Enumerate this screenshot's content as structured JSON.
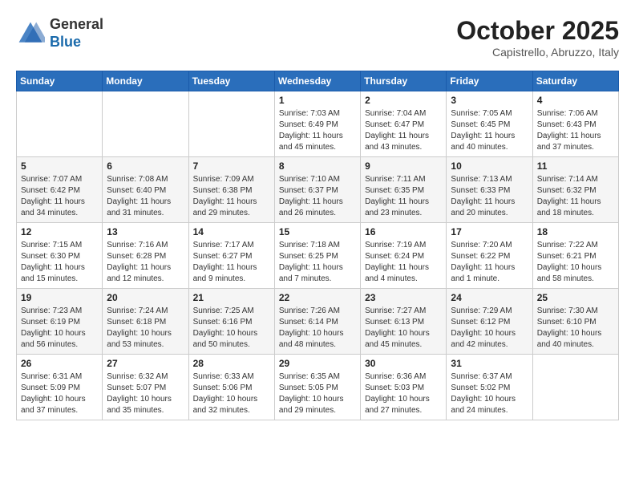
{
  "header": {
    "logo": {
      "general": "General",
      "blue": "Blue"
    },
    "title": "October 2025",
    "subtitle": "Capistrello, Abruzzo, Italy"
  },
  "calendar": {
    "weekdays": [
      "Sunday",
      "Monday",
      "Tuesday",
      "Wednesday",
      "Thursday",
      "Friday",
      "Saturday"
    ],
    "weeks": [
      [
        {
          "day": "",
          "info": ""
        },
        {
          "day": "",
          "info": ""
        },
        {
          "day": "",
          "info": ""
        },
        {
          "day": "1",
          "info": "Sunrise: 7:03 AM\nSunset: 6:49 PM\nDaylight: 11 hours and 45 minutes."
        },
        {
          "day": "2",
          "info": "Sunrise: 7:04 AM\nSunset: 6:47 PM\nDaylight: 11 hours and 43 minutes."
        },
        {
          "day": "3",
          "info": "Sunrise: 7:05 AM\nSunset: 6:45 PM\nDaylight: 11 hours and 40 minutes."
        },
        {
          "day": "4",
          "info": "Sunrise: 7:06 AM\nSunset: 6:43 PM\nDaylight: 11 hours and 37 minutes."
        }
      ],
      [
        {
          "day": "5",
          "info": "Sunrise: 7:07 AM\nSunset: 6:42 PM\nDaylight: 11 hours and 34 minutes."
        },
        {
          "day": "6",
          "info": "Sunrise: 7:08 AM\nSunset: 6:40 PM\nDaylight: 11 hours and 31 minutes."
        },
        {
          "day": "7",
          "info": "Sunrise: 7:09 AM\nSunset: 6:38 PM\nDaylight: 11 hours and 29 minutes."
        },
        {
          "day": "8",
          "info": "Sunrise: 7:10 AM\nSunset: 6:37 PM\nDaylight: 11 hours and 26 minutes."
        },
        {
          "day": "9",
          "info": "Sunrise: 7:11 AM\nSunset: 6:35 PM\nDaylight: 11 hours and 23 minutes."
        },
        {
          "day": "10",
          "info": "Sunrise: 7:13 AM\nSunset: 6:33 PM\nDaylight: 11 hours and 20 minutes."
        },
        {
          "day": "11",
          "info": "Sunrise: 7:14 AM\nSunset: 6:32 PM\nDaylight: 11 hours and 18 minutes."
        }
      ],
      [
        {
          "day": "12",
          "info": "Sunrise: 7:15 AM\nSunset: 6:30 PM\nDaylight: 11 hours and 15 minutes."
        },
        {
          "day": "13",
          "info": "Sunrise: 7:16 AM\nSunset: 6:28 PM\nDaylight: 11 hours and 12 minutes."
        },
        {
          "day": "14",
          "info": "Sunrise: 7:17 AM\nSunset: 6:27 PM\nDaylight: 11 hours and 9 minutes."
        },
        {
          "day": "15",
          "info": "Sunrise: 7:18 AM\nSunset: 6:25 PM\nDaylight: 11 hours and 7 minutes."
        },
        {
          "day": "16",
          "info": "Sunrise: 7:19 AM\nSunset: 6:24 PM\nDaylight: 11 hours and 4 minutes."
        },
        {
          "day": "17",
          "info": "Sunrise: 7:20 AM\nSunset: 6:22 PM\nDaylight: 11 hours and 1 minute."
        },
        {
          "day": "18",
          "info": "Sunrise: 7:22 AM\nSunset: 6:21 PM\nDaylight: 10 hours and 58 minutes."
        }
      ],
      [
        {
          "day": "19",
          "info": "Sunrise: 7:23 AM\nSunset: 6:19 PM\nDaylight: 10 hours and 56 minutes."
        },
        {
          "day": "20",
          "info": "Sunrise: 7:24 AM\nSunset: 6:18 PM\nDaylight: 10 hours and 53 minutes."
        },
        {
          "day": "21",
          "info": "Sunrise: 7:25 AM\nSunset: 6:16 PM\nDaylight: 10 hours and 50 minutes."
        },
        {
          "day": "22",
          "info": "Sunrise: 7:26 AM\nSunset: 6:14 PM\nDaylight: 10 hours and 48 minutes."
        },
        {
          "day": "23",
          "info": "Sunrise: 7:27 AM\nSunset: 6:13 PM\nDaylight: 10 hours and 45 minutes."
        },
        {
          "day": "24",
          "info": "Sunrise: 7:29 AM\nSunset: 6:12 PM\nDaylight: 10 hours and 42 minutes."
        },
        {
          "day": "25",
          "info": "Sunrise: 7:30 AM\nSunset: 6:10 PM\nDaylight: 10 hours and 40 minutes."
        }
      ],
      [
        {
          "day": "26",
          "info": "Sunrise: 6:31 AM\nSunset: 5:09 PM\nDaylight: 10 hours and 37 minutes."
        },
        {
          "day": "27",
          "info": "Sunrise: 6:32 AM\nSunset: 5:07 PM\nDaylight: 10 hours and 35 minutes."
        },
        {
          "day": "28",
          "info": "Sunrise: 6:33 AM\nSunset: 5:06 PM\nDaylight: 10 hours and 32 minutes."
        },
        {
          "day": "29",
          "info": "Sunrise: 6:35 AM\nSunset: 5:05 PM\nDaylight: 10 hours and 29 minutes."
        },
        {
          "day": "30",
          "info": "Sunrise: 6:36 AM\nSunset: 5:03 PM\nDaylight: 10 hours and 27 minutes."
        },
        {
          "day": "31",
          "info": "Sunrise: 6:37 AM\nSunset: 5:02 PM\nDaylight: 10 hours and 24 minutes."
        },
        {
          "day": "",
          "info": ""
        }
      ]
    ]
  }
}
